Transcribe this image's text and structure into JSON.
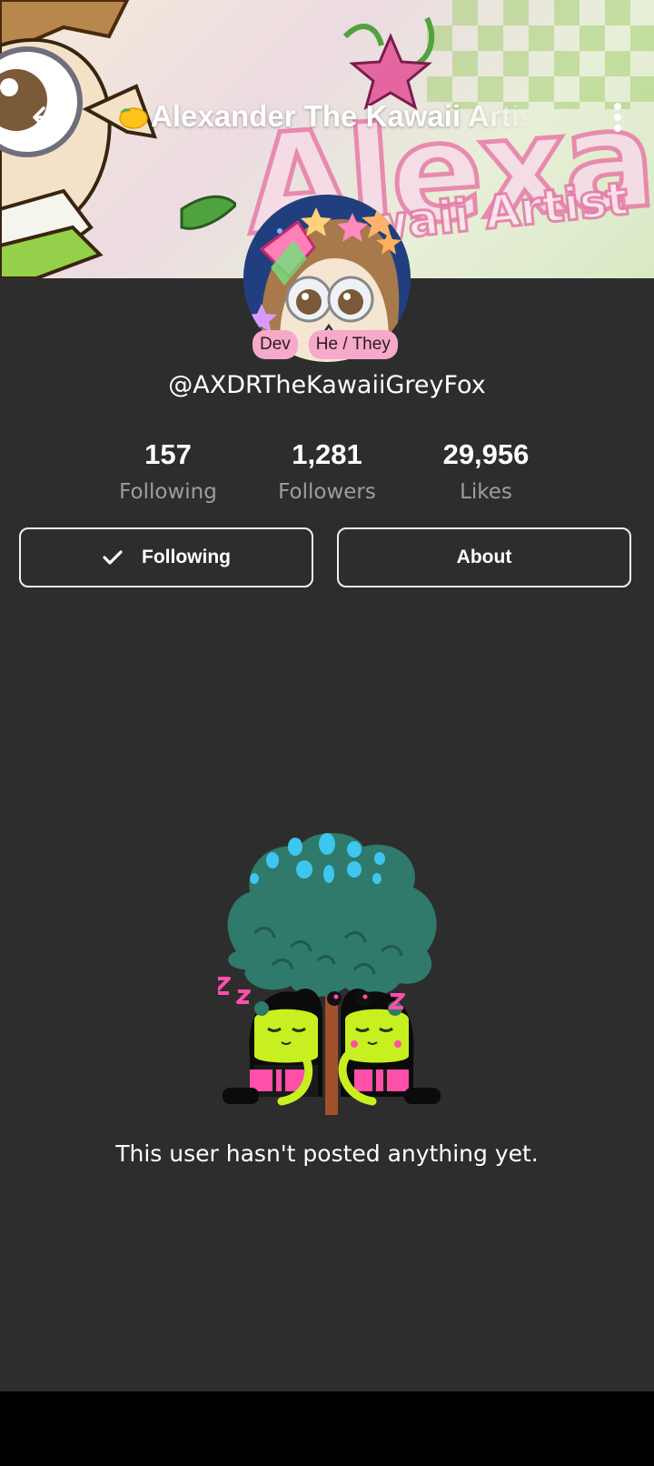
{
  "header": {
    "title": "Alexander The Kawaii Artist",
    "title_emoji": "lemon-emoji",
    "back_icon": "arrow-left-icon",
    "menu_icon": "more-vertical-icon"
  },
  "banner": {
    "art_text": "Alexander",
    "art_subtext": "Kawaii Artist"
  },
  "profile": {
    "badges": [
      "Dev",
      "He / They"
    ],
    "username": "@AXDRTheKawaiiGreyFox"
  },
  "stats": [
    {
      "value": "157",
      "label": "Following"
    },
    {
      "value": "1,281",
      "label": "Followers"
    },
    {
      "value": "29,956",
      "label": "Likes"
    }
  ],
  "actions": {
    "following_label": "Following",
    "about_label": "About"
  },
  "empty_state": {
    "message": "This user hasn't posted anything yet."
  },
  "colors": {
    "background": "#2d2d2e",
    "badge": "#f7a9c9",
    "muted_text": "#9d9d9f",
    "accent_pink": "#ff4fa8",
    "tree_green": "#2f7a6a"
  }
}
